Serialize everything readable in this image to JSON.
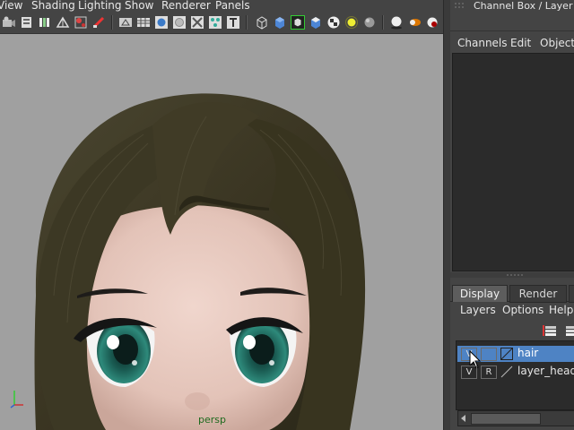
{
  "menubar": {
    "items": [
      "View",
      "Shading",
      "Lighting",
      "Show",
      "Renderer",
      "Panels"
    ]
  },
  "toolbar": {
    "icons": [
      "camera-attributes-icon",
      "bookmarks-icon",
      "image-plane-icon",
      "grid-icon",
      "film-gate-icon",
      "resolution-gate-icon",
      "wireframe-icon",
      "smooth-shade-icon",
      "flat-shade-icon",
      "bounding-box-icon",
      "points-icon",
      "texture-icon",
      "text-icon",
      "wireframe-cube-icon",
      "smooth-cube-icon",
      "isolate-select-icon",
      "default-material-icon",
      "xray-icon",
      "use-lights-icon",
      "shadows-icon",
      "ambient-occlusion-icon",
      "motion-blur-icon",
      "anti-alias-icon"
    ]
  },
  "viewport": {
    "camera_label": "persp"
  },
  "channel_box": {
    "title": "Channel Box / Layer Edi",
    "menus": [
      "Channels",
      "Edit",
      "Object"
    ]
  },
  "layer_editor": {
    "tabs": [
      "Display",
      "Render"
    ],
    "active_tab": "Display",
    "menus": [
      "Layers",
      "Options",
      "Help"
    ],
    "layers": [
      {
        "visible": "V",
        "type": "",
        "name": "hair",
        "selected": true
      },
      {
        "visible": "V",
        "type": "R",
        "name": "layer_head",
        "selected": false
      }
    ]
  },
  "colors": {
    "viewport_bg": "#a0a0a0",
    "hair": "#3e3a26",
    "skin": "#e6c8be",
    "iris": "#1d5f56",
    "selection": "#4e83c4"
  }
}
